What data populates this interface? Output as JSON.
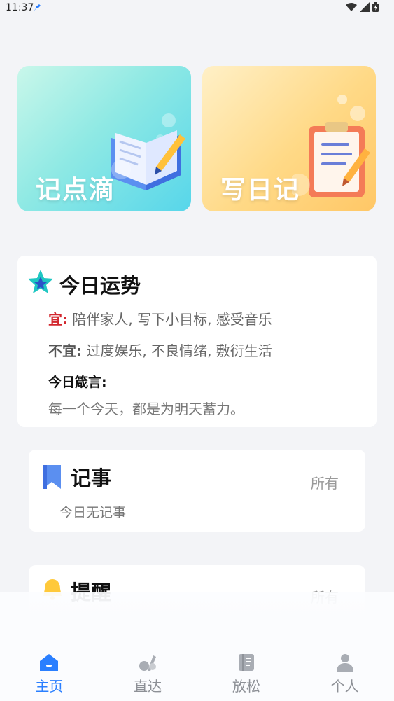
{
  "status_bar": {
    "time": "11:37"
  },
  "cards": {
    "left_title": "记点滴",
    "right_title": "写日记"
  },
  "fortune": {
    "title": "今日运势",
    "good_label": "宜:",
    "good_text": "陪伴家人, 写下小目标, 感受音乐",
    "bad_label": "不宜:",
    "bad_text": "过度娱乐, 不良情绪, 敷衍生活",
    "motto_label": "今日箴言:",
    "motto_text": "每一个今天，都是为明天蓄力。"
  },
  "notes": {
    "title": "记事",
    "all_label": "所有",
    "empty_text": "今日无记事"
  },
  "reminders": {
    "title": "提醒",
    "all_label": "所有"
  },
  "nav": {
    "items": [
      {
        "label": "主页",
        "icon": "home-icon"
      },
      {
        "label": "直达",
        "icon": "direct-icon"
      },
      {
        "label": "放松",
        "icon": "relax-icon"
      },
      {
        "label": "个人",
        "icon": "profile-icon"
      }
    ],
    "active_color": "#2a7fff",
    "inactive_color": "#8d9096"
  }
}
